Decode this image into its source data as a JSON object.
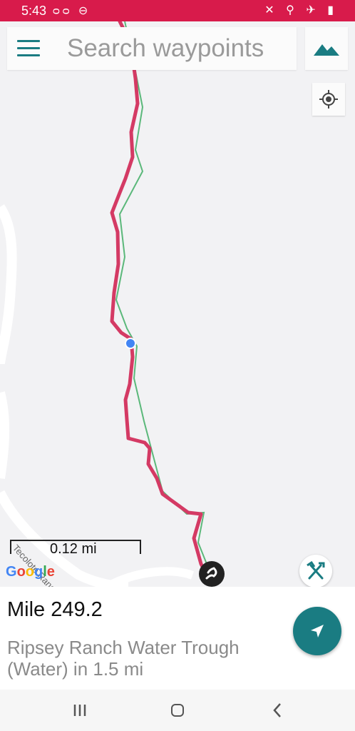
{
  "status_bar": {
    "time": "5:43",
    "left_icons": [
      "voicemail-icon",
      "dnd-icon"
    ],
    "right_icons": [
      "mute-icon",
      "location-icon",
      "airplane-icon",
      "battery-icon"
    ],
    "color": "#d81b4b"
  },
  "search": {
    "placeholder": "Search waypoints"
  },
  "map": {
    "scale_label": "0.12 mi",
    "attribution": "Google",
    "road_label": "Tecolote Ranch Rd",
    "trail_color": "#d43a64",
    "route_color": "#5bb87a",
    "location_dot_color": "#4285f4"
  },
  "panel": {
    "mile": "Mile 249.2",
    "waypoint": "Ripsey Ranch Water Trough (Water) in 1.5 mi"
  },
  "accent_color": "#1a7c82"
}
